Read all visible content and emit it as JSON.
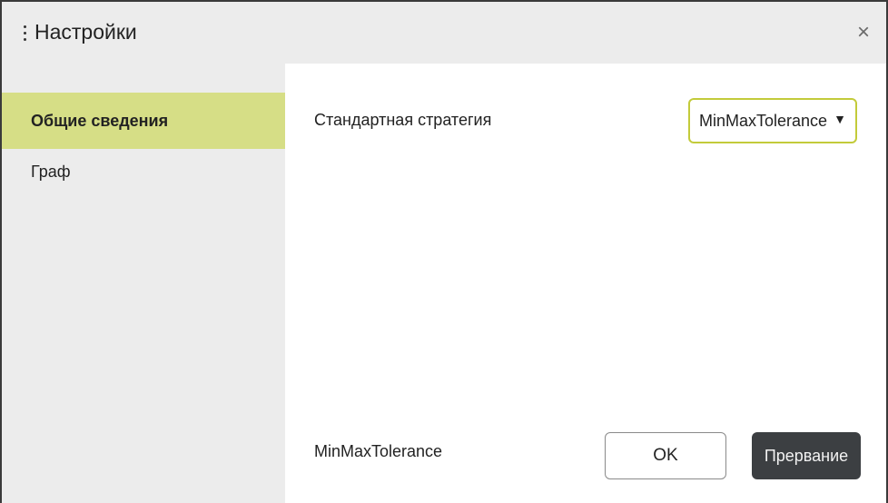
{
  "window": {
    "title": "Настройки",
    "close_glyph": "×"
  },
  "sidebar": {
    "items": [
      {
        "label": "Общие сведения",
        "active": true
      },
      {
        "label": "Граф",
        "active": false
      }
    ]
  },
  "main": {
    "strategy_label": "Стандартная стратегия",
    "strategy_select": {
      "value": "MinMaxTolerance",
      "arrow_glyph": "▼"
    },
    "footer_text": "MinMaxTolerance"
  },
  "buttons": {
    "ok_label": "OK",
    "cancel_label": "Прервание"
  },
  "colors": {
    "accent": "#d6de86",
    "select_border": "#c3cb3a",
    "cancel_bg": "#3c3f42",
    "panel_bg": "#ececec"
  }
}
